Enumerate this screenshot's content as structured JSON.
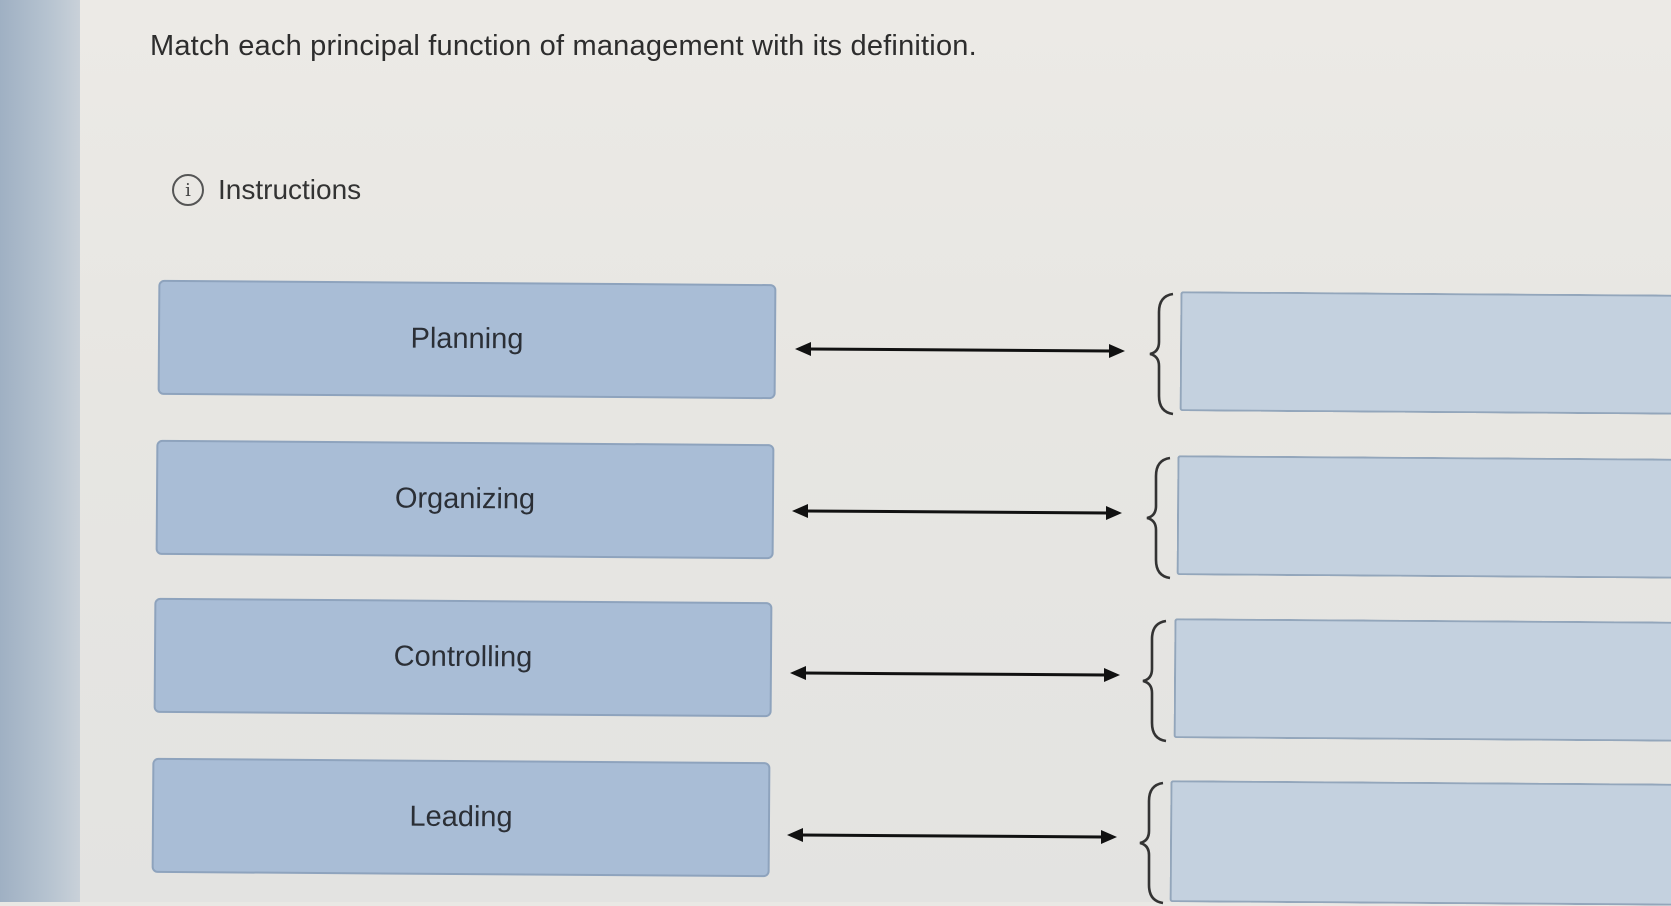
{
  "question": {
    "text": "Match each principal function of management with its definition."
  },
  "instructions": {
    "label": "Instructions",
    "icon": "info-icon"
  },
  "terms": [
    {
      "label": "Planning"
    },
    {
      "label": "Organizing"
    },
    {
      "label": "Controlling"
    },
    {
      "label": "Leading"
    }
  ],
  "drop_zones": [
    {
      "value": ""
    },
    {
      "value": ""
    },
    {
      "value": ""
    },
    {
      "value": ""
    }
  ],
  "colors": {
    "term_fill": "#a9bdd6",
    "drop_fill": "#c4d1df",
    "arrow": "#111111"
  }
}
